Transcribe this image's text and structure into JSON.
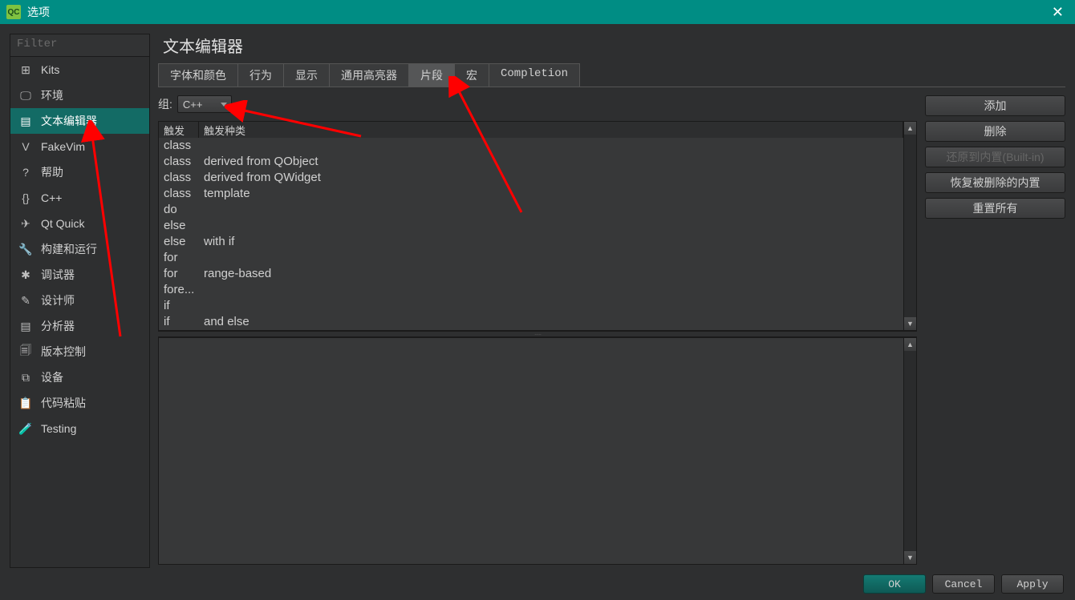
{
  "window": {
    "title": "选项",
    "logo_text": "QC"
  },
  "sidebar": {
    "filter_placeholder": "Filter",
    "items": [
      {
        "label": "Kits",
        "icon": "⊞"
      },
      {
        "label": "环境",
        "icon": "🖵"
      },
      {
        "label": "文本编辑器",
        "icon": "▤"
      },
      {
        "label": "FakeVim",
        "icon": "V"
      },
      {
        "label": "帮助",
        "icon": "?"
      },
      {
        "label": "C++",
        "icon": "{}"
      },
      {
        "label": "Qt Quick",
        "icon": "✈"
      },
      {
        "label": "构建和运行",
        "icon": "🔧"
      },
      {
        "label": "调试器",
        "icon": "✱"
      },
      {
        "label": "设计师",
        "icon": "✎"
      },
      {
        "label": "分析器",
        "icon": "▤"
      },
      {
        "label": "版本控制",
        "icon": "🗐"
      },
      {
        "label": "设备",
        "icon": "⧉"
      },
      {
        "label": "代码粘贴",
        "icon": "📋"
      },
      {
        "label": "Testing",
        "icon": "🧪"
      }
    ]
  },
  "content": {
    "title": "文本编辑器",
    "tabs": [
      {
        "label": "字体和颜色"
      },
      {
        "label": "行为"
      },
      {
        "label": "显示"
      },
      {
        "label": "通用高亮器"
      },
      {
        "label": "片段"
      },
      {
        "label": "宏"
      },
      {
        "label": "Completion"
      }
    ],
    "group": {
      "label": "组:",
      "value": "C++"
    },
    "table": {
      "headers": {
        "trigger": "触发",
        "variant": "触发种类"
      },
      "rows": [
        {
          "trigger": "class",
          "variant": ""
        },
        {
          "trigger": "class",
          "variant": "derived from QObject"
        },
        {
          "trigger": "class",
          "variant": "derived from QWidget"
        },
        {
          "trigger": "class",
          "variant": "template"
        },
        {
          "trigger": "do",
          "variant": ""
        },
        {
          "trigger": "else",
          "variant": ""
        },
        {
          "trigger": "else",
          "variant": "with if"
        },
        {
          "trigger": "for",
          "variant": ""
        },
        {
          "trigger": "for",
          "variant": "range-based"
        },
        {
          "trigger": "fore...",
          "variant": ""
        },
        {
          "trigger": "if",
          "variant": ""
        },
        {
          "trigger": "if",
          "variant": "and else"
        }
      ]
    },
    "buttons": {
      "add": "添加",
      "remove": "删除",
      "restore_builtin": "还原到内置(Built-in)",
      "restore_removed": "恢复被删除的内置",
      "reset_all": "重置所有"
    }
  },
  "footer": {
    "ok": "OK",
    "cancel": "Cancel",
    "apply": "Apply"
  }
}
